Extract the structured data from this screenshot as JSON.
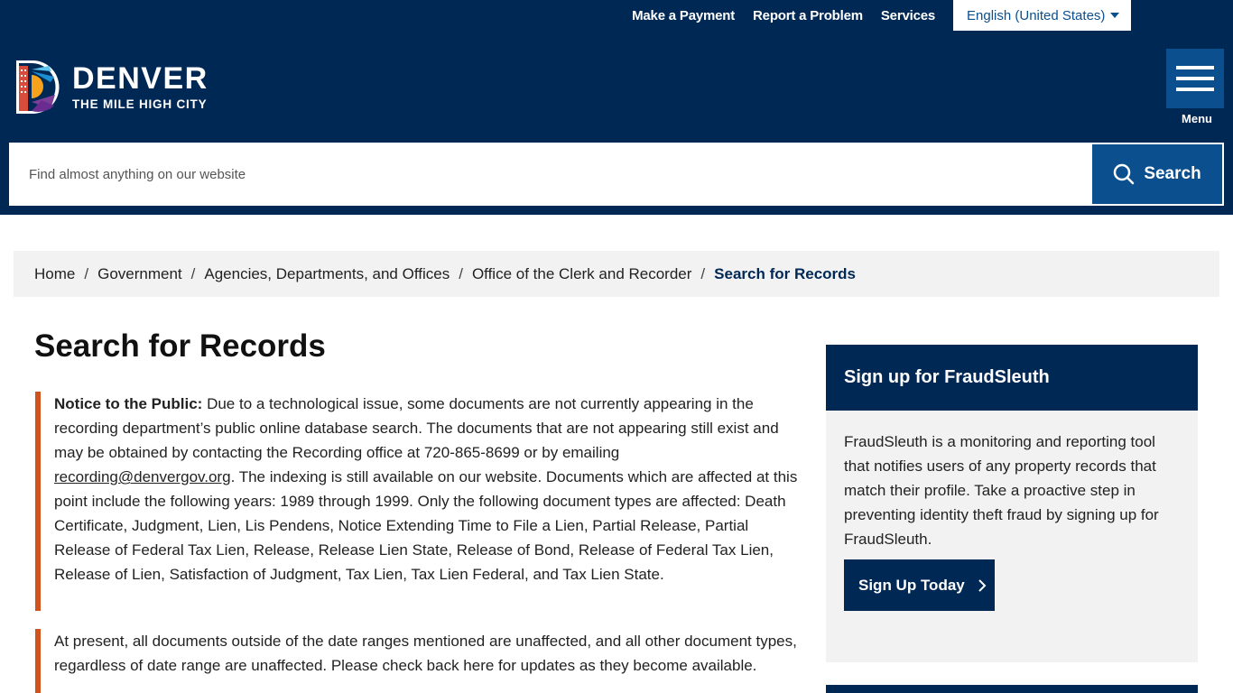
{
  "utility": {
    "links": [
      "Make a Payment",
      "Report a Problem",
      "Services"
    ],
    "language": "English (United States)"
  },
  "logo": {
    "title": "DENVER",
    "subtitle": "THE MILE HIGH CITY"
  },
  "menu": {
    "label": "Menu"
  },
  "search": {
    "placeholder": "Find almost anything on our website",
    "button_label": "Search"
  },
  "breadcrumb": {
    "items": [
      "Home",
      "Government",
      "Agencies, Departments, and Offices",
      "Office of the Clerk and Recorder"
    ],
    "current": "Search for Records"
  },
  "main": {
    "title": "Search for Records",
    "notice1": {
      "label": "Notice to the Public:",
      "text_a": " Due to a technological issue, some documents are not currently appearing in the recording department’s public online database search.  The documents that are not appearing still exist and may be obtained by contacting the Recording office at 720-865-8699 or by emailing ",
      "email": "recording@denvergov.org",
      "text_b": ".  The indexing is still available on our website.  Documents which are affected at this point include the following years:  1989 through 1999.  Only the following document types are affected:  Death Certificate, Judgment, Lien, Lis Pendens, Notice Extending Time to File a Lien, Partial Release, Partial Release of Federal Tax Lien, Release, Release Lien State, Release of Bond, Release of Federal Tax Lien, Release of Lien, Satisfaction of Judgment, Tax Lien, Tax Lien Federal, and Tax Lien State."
    },
    "notice2": {
      "text": "At present, all documents outside of the date ranges mentioned are unaffected, and all other document types, regardless of date range are unaffected.  Please check back here for updates as they become available."
    }
  },
  "sidebar": {
    "heading": "Sign up for FraudSleuth",
    "body": "FraudSleuth is a monitoring and reporting tool that notifies users of any property records that match their profile. Take a proactive step in preventing identity theft fraud by signing up for FraudSleuth.",
    "button_label": "Sign Up Today"
  },
  "colors": {
    "header_bg": "#002855",
    "accent_blue": "#0b4f8f",
    "notice_border": "#d0531d",
    "panel_bg": "#f2f2f2"
  }
}
